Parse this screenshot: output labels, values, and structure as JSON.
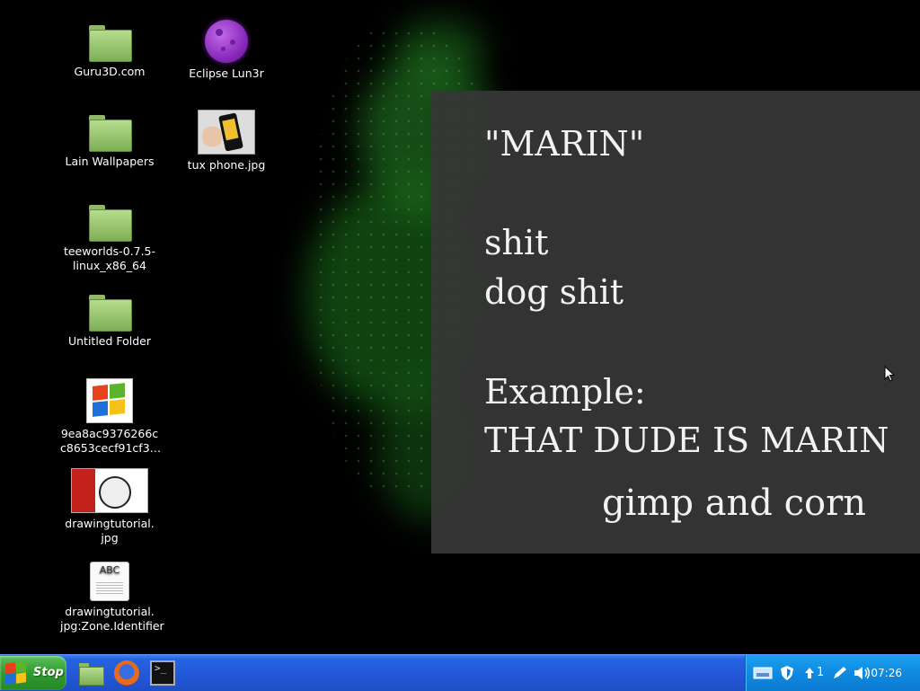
{
  "desktop": {
    "icons": [
      {
        "label": "Guru3D.com",
        "icon": "folder-icon"
      },
      {
        "label": "Eclipse Lun3r",
        "icon": "purple-moon-icon"
      },
      {
        "label": "Lain Wallpapers",
        "icon": "folder-icon"
      },
      {
        "label": "tux phone.jpg",
        "icon": "image-thumbnail-icon"
      },
      {
        "label": "teeworlds-0.7.5-linux_x86_64",
        "line1": "teeworlds-0.7.5-",
        "line2": "linux_x86_64",
        "icon": "folder-icon"
      },
      {
        "label": "Untitled Folder",
        "icon": "folder-icon"
      },
      {
        "label": "9ea8ac9376266cc8653cecf91cf3…",
        "line1": "9ea8ac9376266c",
        "line2": "c8653cecf91cf3…",
        "icon": "windows-logo-icon"
      },
      {
        "label": "drawingtutorial.jpg",
        "line1": "drawingtutorial.",
        "line2": "jpg",
        "icon": "image-thumbnail-icon"
      },
      {
        "label": "drawingtutorial.jpg:Zone.Identifier",
        "line1": "drawingtutorial.",
        "line2": "jpg:Zone.Identifier",
        "icon": "text-document-icon",
        "glyph_text": "ABC"
      }
    ]
  },
  "wallpaper_text": {
    "lines": [
      "\"MARIN\"",
      "shit",
      "dog shit",
      "Example:",
      "THAT DUDE IS MARIN"
    ],
    "signature": "gimp and corn"
  },
  "taskbar": {
    "start_label": "Stop",
    "quick_launch": [
      "file-manager-icon",
      "firefox-icon",
      "terminal-icon"
    ],
    "terminal_glyph": ">_",
    "tray": {
      "network_icon": "network-icon",
      "shield_icon": "shield-icon",
      "update_count": "1",
      "clock": "07:26"
    }
  },
  "colors": {
    "taskbar": "#2257d6",
    "start_button": "#2f9a2f",
    "tray": "#0f8ae0",
    "panel": "#373737",
    "wallpaper_glow": "#2a8a2a"
  }
}
